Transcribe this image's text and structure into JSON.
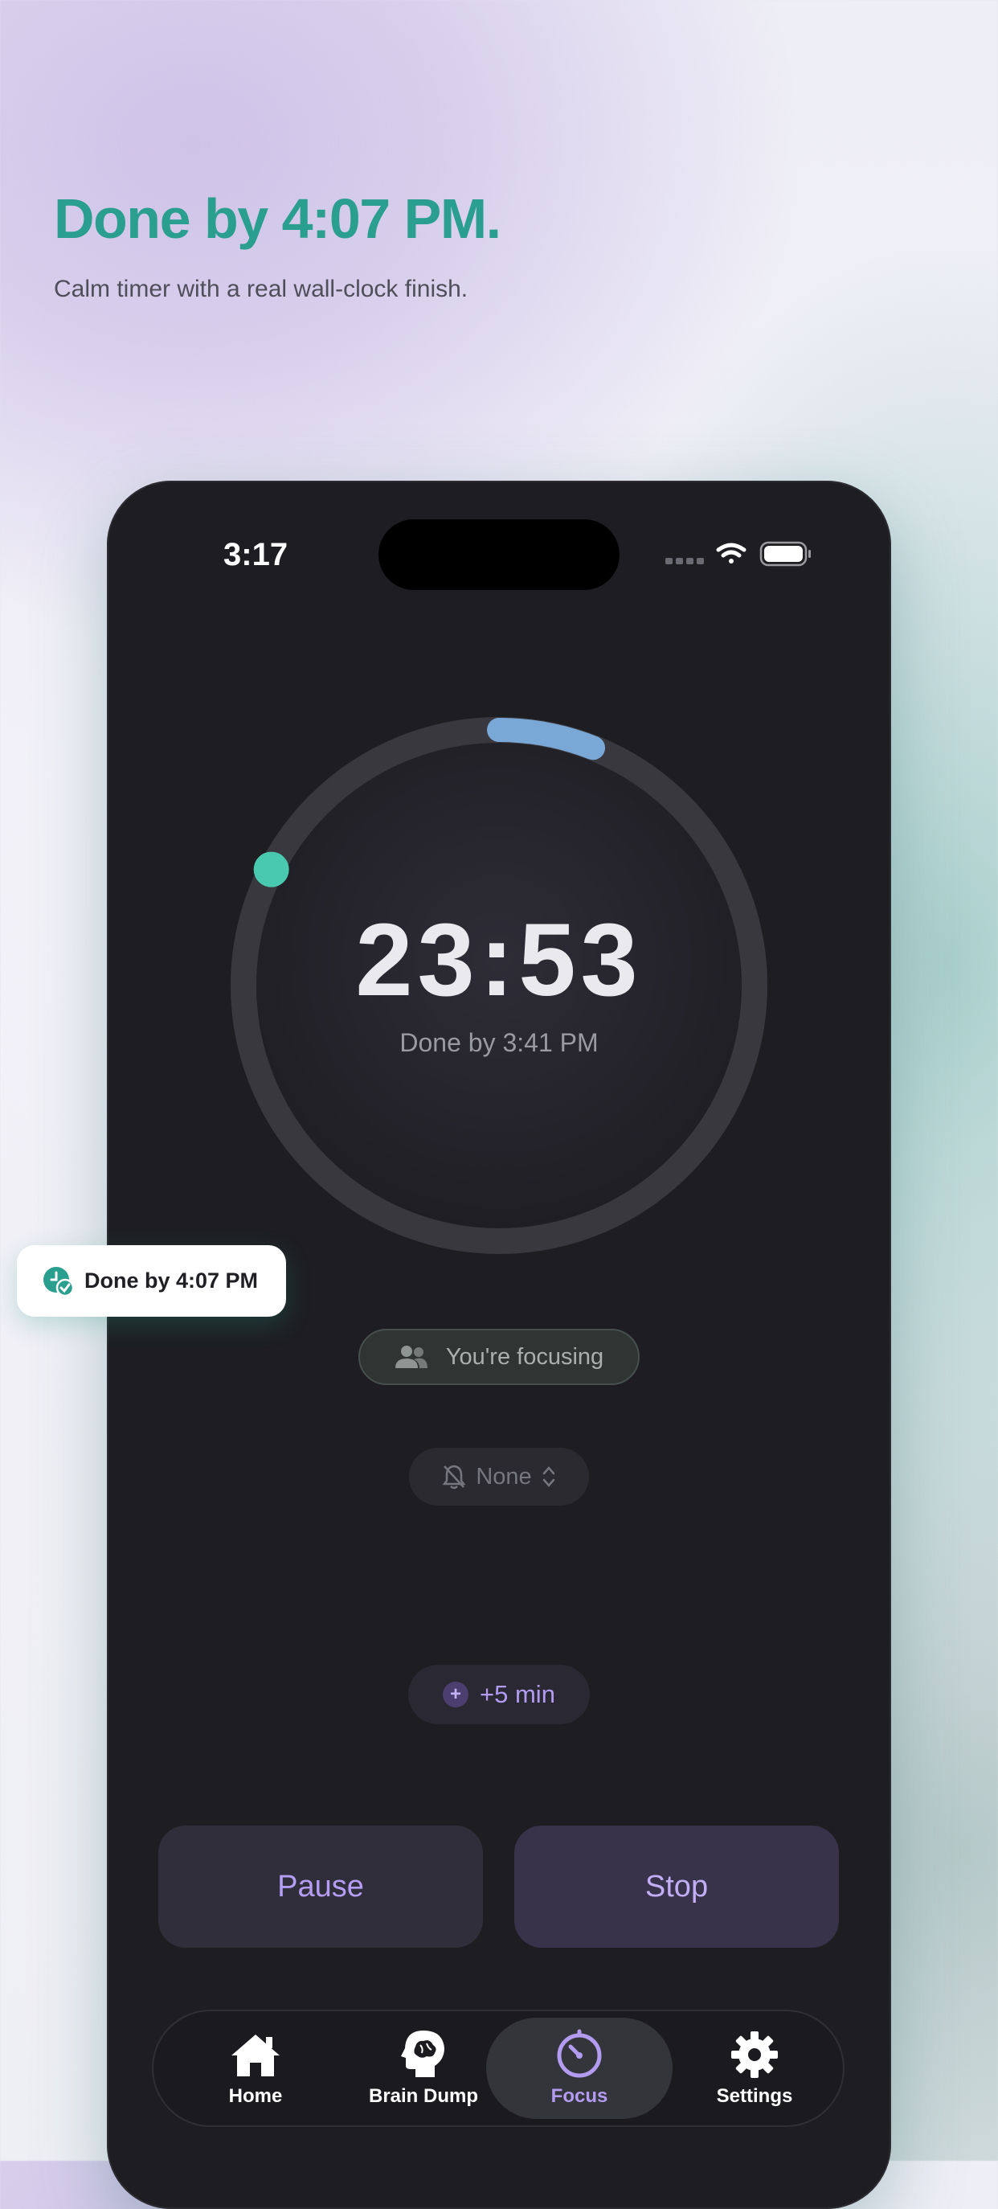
{
  "promo": {
    "headline": "Done by 4:07 PM.",
    "subhead": "Calm timer with a real wall-clock finish."
  },
  "status_bar": {
    "time": "3:17",
    "icons": [
      "signal-dots-icon",
      "wifi-icon",
      "battery-icon"
    ]
  },
  "timer": {
    "remaining": "23:53",
    "done_by": "Done by 3:41 PM",
    "progress_fraction": 0.06,
    "progress_color": "#7aa8d6",
    "marker_color": "#48c9b0"
  },
  "focus_pill": {
    "label": "You're focusing",
    "icon": "people-icon"
  },
  "sound_picker": {
    "value": "None",
    "icon": "bell-slash-icon"
  },
  "extend_button": {
    "label": "+5 min"
  },
  "controls": {
    "pause_label": "Pause",
    "stop_label": "Stop"
  },
  "tabs": [
    {
      "label": "Home",
      "icon": "house-icon",
      "active": false
    },
    {
      "label": "Brain Dump",
      "icon": "brain-head-icon",
      "active": false
    },
    {
      "label": "Focus",
      "icon": "timer-icon",
      "active": true
    },
    {
      "label": "Settings",
      "icon": "gear-icon",
      "active": false
    }
  ],
  "toast": {
    "label": "Done by 4:07 PM"
  },
  "colors": {
    "accent_teal": "#2a9e8f",
    "accent_purple": "#b39cf0",
    "phone_bg": "#1e1e22"
  }
}
